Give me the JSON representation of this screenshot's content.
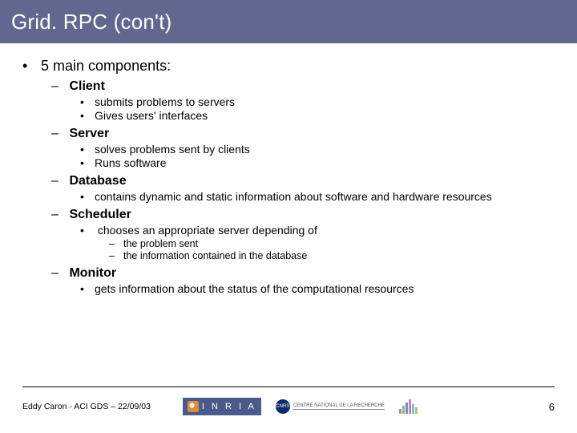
{
  "title": "Grid. RPC (con't)",
  "main": {
    "heading": "5 main components:",
    "components": [
      {
        "name": "Client",
        "points": [
          {
            "text": "submits problems to servers"
          },
          {
            "text": "Gives users' interfaces"
          }
        ]
      },
      {
        "name": "Server",
        "points": [
          {
            "text": "solves problems sent by clients"
          },
          {
            "text": "Runs software"
          }
        ]
      },
      {
        "name": "Database",
        "points": [
          {
            "text": "contains dynamic and static information about software and hardware resources"
          }
        ]
      },
      {
        "name": "Scheduler",
        "points": [
          {
            "text": "chooses an appropriate server depending of",
            "sub": [
              "the problem sent",
              "the information contained in the database"
            ]
          }
        ]
      },
      {
        "name": "Monitor",
        "points": [
          {
            "text": "gets information about the status of the computational resources"
          }
        ]
      }
    ]
  },
  "footer": {
    "author_line": "Eddy Caron - ACI GDS – 22/09/03",
    "logos": {
      "inria": "I N R I A",
      "cnrs": "CNRS",
      "cnrs_sub": "CENTRE NATIONAL\nDE LA RECHERCHE"
    },
    "page": "6"
  }
}
